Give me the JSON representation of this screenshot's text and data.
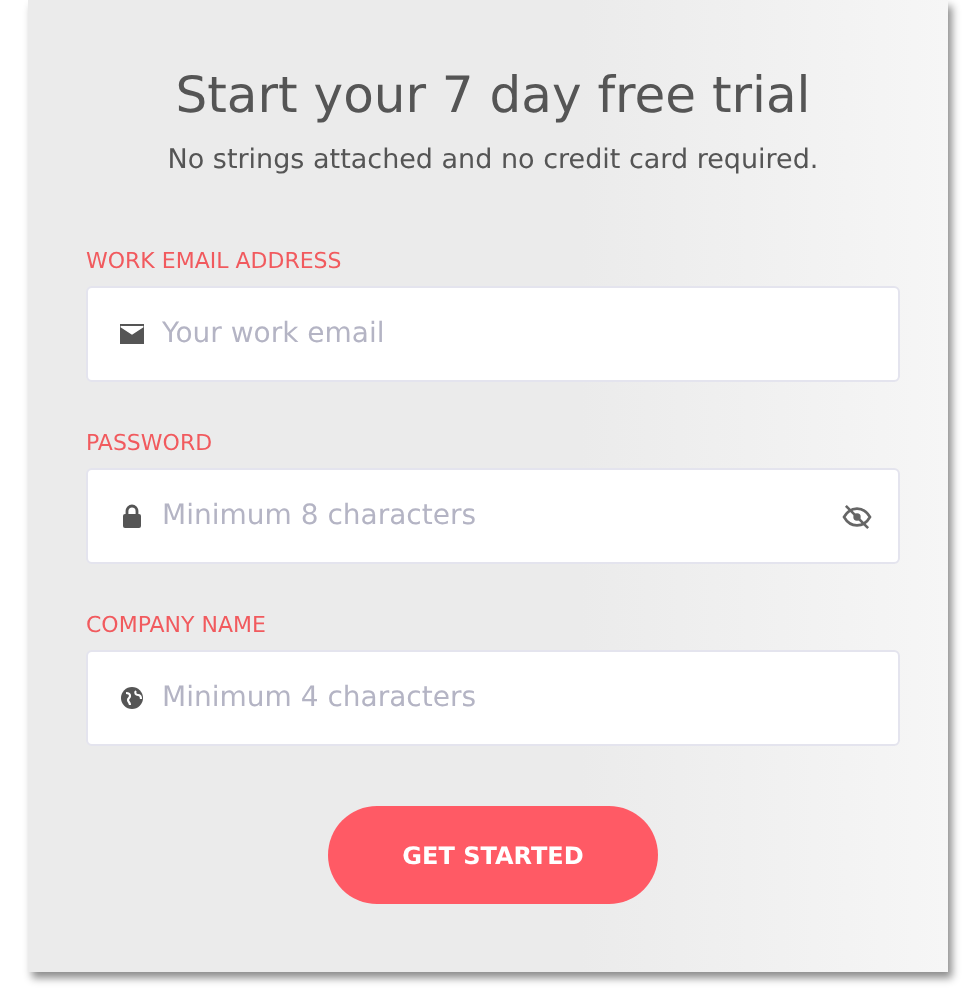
{
  "heading": {
    "title": "Start your 7 day free trial",
    "subtitle": "No strings attached and no credit card required."
  },
  "fields": [
    {
      "kind": "email",
      "label": "WORK EMAIL ADDRESS",
      "placeholder": "Your work email"
    },
    {
      "kind": "password",
      "label": "PASSWORD",
      "placeholder": "Minimum 8 characters"
    },
    {
      "kind": "company",
      "label": "COMPANY NAME",
      "placeholder": "Minimum 4 characters"
    }
  ],
  "submit": {
    "label": "GET STARTED"
  }
}
